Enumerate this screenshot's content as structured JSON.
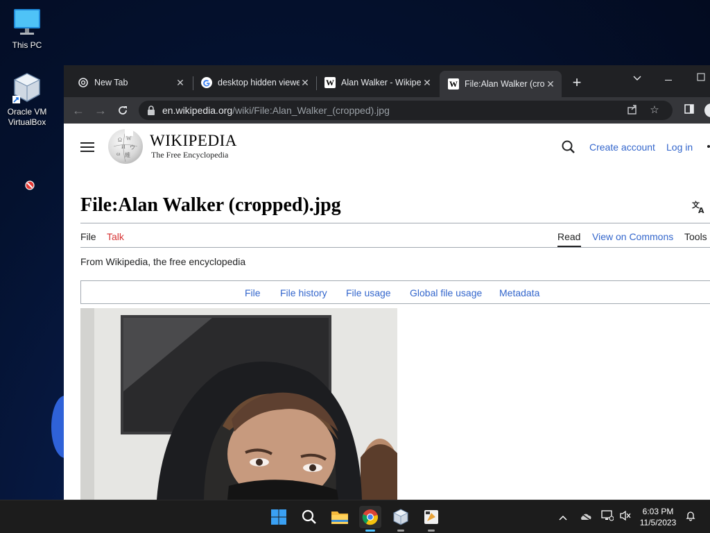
{
  "desktop": {
    "icons": [
      {
        "label": "This PC",
        "icon": "monitor-icon"
      },
      {
        "label": "Oracle VM VirtualBox",
        "icon": "virtualbox-icon"
      }
    ]
  },
  "browser": {
    "tabs": [
      {
        "title": "New Tab",
        "favicon": "chrome-icon",
        "active": false
      },
      {
        "title": "desktop hidden viewer",
        "favicon": "google-icon",
        "active": false
      },
      {
        "title": "Alan Walker - Wikipedia",
        "favicon": "wikipedia-icon",
        "active": false
      },
      {
        "title": "File:Alan Walker (cropped).jpg",
        "favicon": "wikipedia-icon",
        "active": true
      }
    ],
    "new_tab_label": "+",
    "address_bar": {
      "host": "en.wikipedia.org",
      "path": "/wiki/File:Alan_Walker_(cropped).jpg"
    }
  },
  "wiki": {
    "wordmark": "WIKIPEDIA",
    "tagline": "The Free Encyclopedia",
    "create_account": "Create account",
    "log_in": "Log in",
    "page_title": "File:Alan Walker (cropped).jpg",
    "namespace_tabs": {
      "file": "File",
      "talk": "Talk"
    },
    "view_tabs": {
      "read": "Read",
      "view_on_commons": "View on Commons",
      "tools": "Tools"
    },
    "from_line": "From Wikipedia, the free encyclopedia",
    "file_toc": [
      "File",
      "File history",
      "File usage",
      "Global file usage",
      "Metadata"
    ]
  },
  "taskbar": {
    "apps": [
      "start-icon",
      "search-icon",
      "file-explorer-icon",
      "chrome-icon",
      "virtualbox-icon",
      "app-icon"
    ],
    "clock": {
      "time": "6:03 PM",
      "date": "11/5/2023"
    }
  },
  "colors": {
    "link_blue": "#3366cc",
    "link_red": "#d73333",
    "chrome_dark": "#202124",
    "chrome_toolbar": "#35363a"
  }
}
